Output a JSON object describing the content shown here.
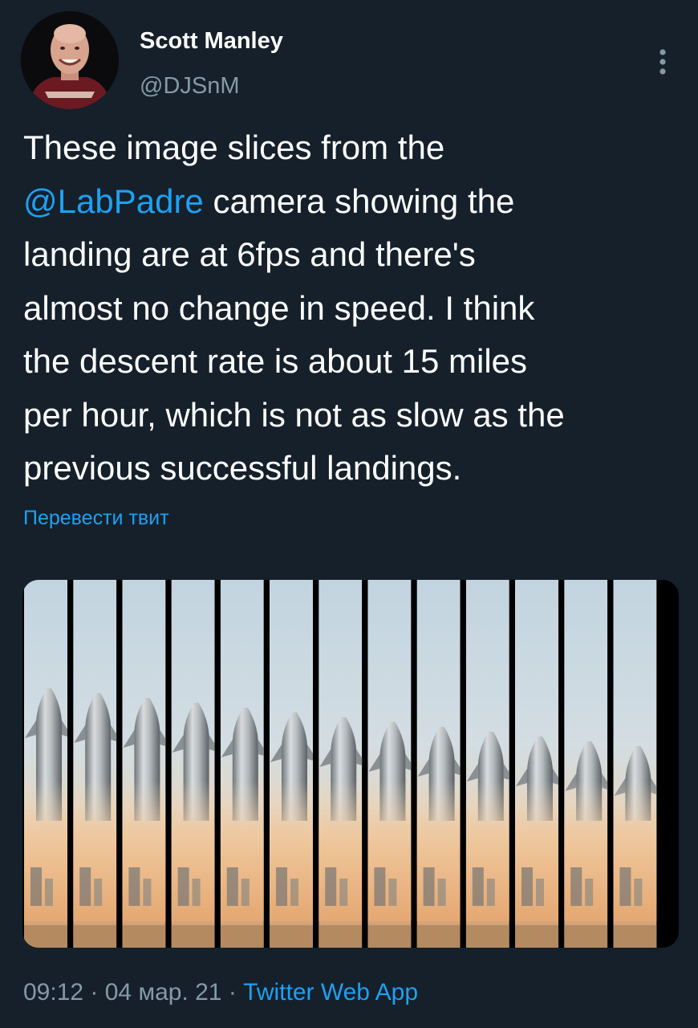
{
  "theme": {
    "background": "#15202b",
    "text_primary": "#ffffff",
    "text_secondary": "#8899a6",
    "accent": "#1da1f2"
  },
  "author": {
    "display_name": "Scott Manley",
    "handle": "@DJSnM",
    "avatar_icon": "user-avatar"
  },
  "tweet": {
    "lines": [
      "These image slices from the",
      "camera showing the",
      "landing are at 6fps and there's",
      "almost no change in speed. I think",
      "the descent rate is about 15 miles",
      "per hour, which is not as slow as the",
      "previous successful landings."
    ],
    "mention": "@LabPadre",
    "translate_label": "Перевести твит"
  },
  "media": {
    "slice_count": 13,
    "icon": "rocket-landing-slices"
  },
  "meta": {
    "time": "09:12",
    "separator": " · ",
    "date": "04 мар. 21",
    "app": "Twitter Web App"
  },
  "icons": {
    "more": "more-vertical-icon"
  }
}
